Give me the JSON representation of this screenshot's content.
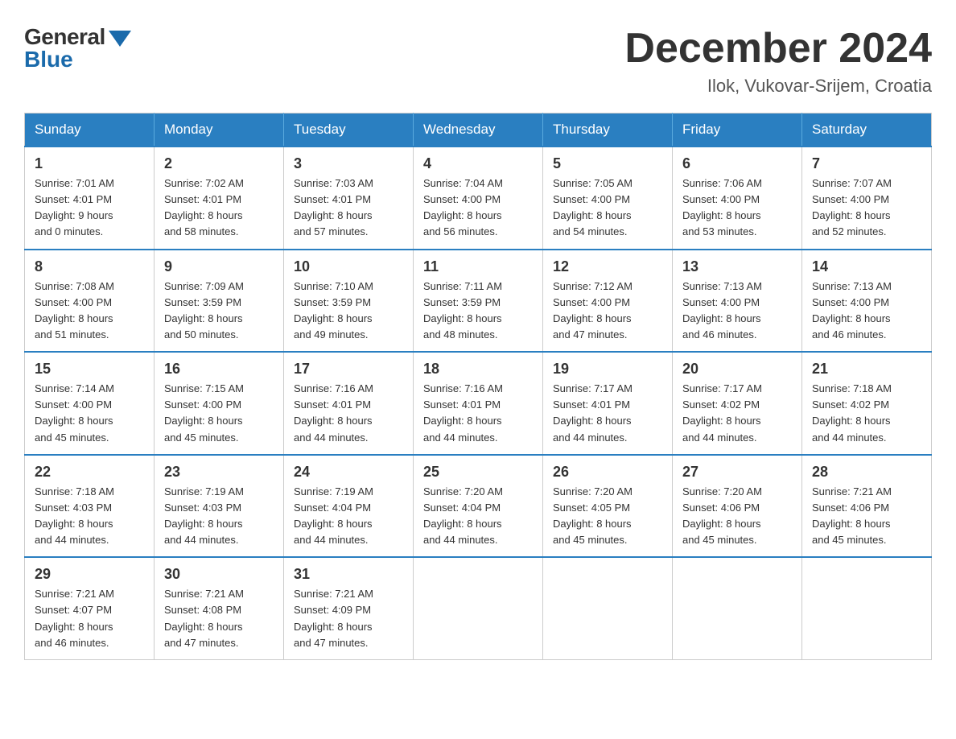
{
  "logo": {
    "general": "General",
    "blue": "Blue"
  },
  "title": "December 2024",
  "location": "Ilok, Vukovar-Srijem, Croatia",
  "headers": [
    "Sunday",
    "Monday",
    "Tuesday",
    "Wednesday",
    "Thursday",
    "Friday",
    "Saturday"
  ],
  "weeks": [
    [
      {
        "day": "1",
        "info": "Sunrise: 7:01 AM\nSunset: 4:01 PM\nDaylight: 9 hours\nand 0 minutes."
      },
      {
        "day": "2",
        "info": "Sunrise: 7:02 AM\nSunset: 4:01 PM\nDaylight: 8 hours\nand 58 minutes."
      },
      {
        "day": "3",
        "info": "Sunrise: 7:03 AM\nSunset: 4:01 PM\nDaylight: 8 hours\nand 57 minutes."
      },
      {
        "day": "4",
        "info": "Sunrise: 7:04 AM\nSunset: 4:00 PM\nDaylight: 8 hours\nand 56 minutes."
      },
      {
        "day": "5",
        "info": "Sunrise: 7:05 AM\nSunset: 4:00 PM\nDaylight: 8 hours\nand 54 minutes."
      },
      {
        "day": "6",
        "info": "Sunrise: 7:06 AM\nSunset: 4:00 PM\nDaylight: 8 hours\nand 53 minutes."
      },
      {
        "day": "7",
        "info": "Sunrise: 7:07 AM\nSunset: 4:00 PM\nDaylight: 8 hours\nand 52 minutes."
      }
    ],
    [
      {
        "day": "8",
        "info": "Sunrise: 7:08 AM\nSunset: 4:00 PM\nDaylight: 8 hours\nand 51 minutes."
      },
      {
        "day": "9",
        "info": "Sunrise: 7:09 AM\nSunset: 3:59 PM\nDaylight: 8 hours\nand 50 minutes."
      },
      {
        "day": "10",
        "info": "Sunrise: 7:10 AM\nSunset: 3:59 PM\nDaylight: 8 hours\nand 49 minutes."
      },
      {
        "day": "11",
        "info": "Sunrise: 7:11 AM\nSunset: 3:59 PM\nDaylight: 8 hours\nand 48 minutes."
      },
      {
        "day": "12",
        "info": "Sunrise: 7:12 AM\nSunset: 4:00 PM\nDaylight: 8 hours\nand 47 minutes."
      },
      {
        "day": "13",
        "info": "Sunrise: 7:13 AM\nSunset: 4:00 PM\nDaylight: 8 hours\nand 46 minutes."
      },
      {
        "day": "14",
        "info": "Sunrise: 7:13 AM\nSunset: 4:00 PM\nDaylight: 8 hours\nand 46 minutes."
      }
    ],
    [
      {
        "day": "15",
        "info": "Sunrise: 7:14 AM\nSunset: 4:00 PM\nDaylight: 8 hours\nand 45 minutes."
      },
      {
        "day": "16",
        "info": "Sunrise: 7:15 AM\nSunset: 4:00 PM\nDaylight: 8 hours\nand 45 minutes."
      },
      {
        "day": "17",
        "info": "Sunrise: 7:16 AM\nSunset: 4:01 PM\nDaylight: 8 hours\nand 44 minutes."
      },
      {
        "day": "18",
        "info": "Sunrise: 7:16 AM\nSunset: 4:01 PM\nDaylight: 8 hours\nand 44 minutes."
      },
      {
        "day": "19",
        "info": "Sunrise: 7:17 AM\nSunset: 4:01 PM\nDaylight: 8 hours\nand 44 minutes."
      },
      {
        "day": "20",
        "info": "Sunrise: 7:17 AM\nSunset: 4:02 PM\nDaylight: 8 hours\nand 44 minutes."
      },
      {
        "day": "21",
        "info": "Sunrise: 7:18 AM\nSunset: 4:02 PM\nDaylight: 8 hours\nand 44 minutes."
      }
    ],
    [
      {
        "day": "22",
        "info": "Sunrise: 7:18 AM\nSunset: 4:03 PM\nDaylight: 8 hours\nand 44 minutes."
      },
      {
        "day": "23",
        "info": "Sunrise: 7:19 AM\nSunset: 4:03 PM\nDaylight: 8 hours\nand 44 minutes."
      },
      {
        "day": "24",
        "info": "Sunrise: 7:19 AM\nSunset: 4:04 PM\nDaylight: 8 hours\nand 44 minutes."
      },
      {
        "day": "25",
        "info": "Sunrise: 7:20 AM\nSunset: 4:04 PM\nDaylight: 8 hours\nand 44 minutes."
      },
      {
        "day": "26",
        "info": "Sunrise: 7:20 AM\nSunset: 4:05 PM\nDaylight: 8 hours\nand 45 minutes."
      },
      {
        "day": "27",
        "info": "Sunrise: 7:20 AM\nSunset: 4:06 PM\nDaylight: 8 hours\nand 45 minutes."
      },
      {
        "day": "28",
        "info": "Sunrise: 7:21 AM\nSunset: 4:06 PM\nDaylight: 8 hours\nand 45 minutes."
      }
    ],
    [
      {
        "day": "29",
        "info": "Sunrise: 7:21 AM\nSunset: 4:07 PM\nDaylight: 8 hours\nand 46 minutes."
      },
      {
        "day": "30",
        "info": "Sunrise: 7:21 AM\nSunset: 4:08 PM\nDaylight: 8 hours\nand 47 minutes."
      },
      {
        "day": "31",
        "info": "Sunrise: 7:21 AM\nSunset: 4:09 PM\nDaylight: 8 hours\nand 47 minutes."
      },
      null,
      null,
      null,
      null
    ]
  ]
}
